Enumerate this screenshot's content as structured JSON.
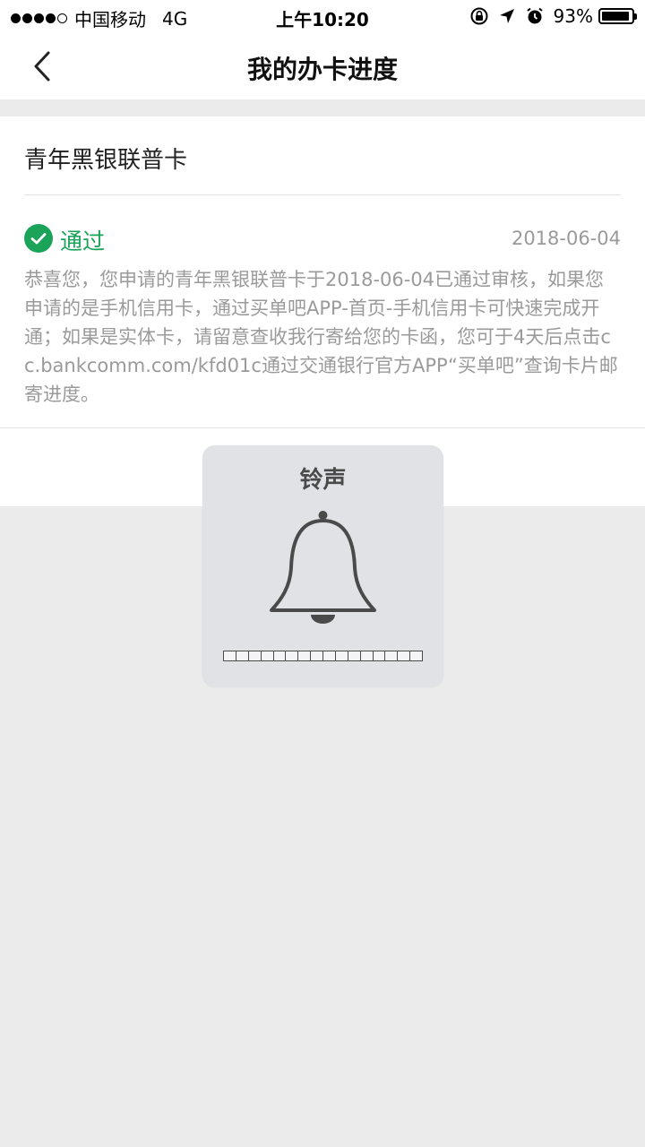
{
  "status_bar": {
    "carrier": "中国移动",
    "network": "4G",
    "time": "上午10:20",
    "battery": "93%",
    "battery_level": 0.93,
    "signal_bars": 4,
    "signal_total": 5
  },
  "nav": {
    "title": "我的办卡进度"
  },
  "card": {
    "name": "青年黑银联普卡",
    "status": "通过",
    "date": "2018-06-04",
    "description": "恭喜您，您申请的青年黑银联普卡于2018-06-04已通过审核，如果您申请的是手机信用卡，通过买单吧APP-首页-手机信用卡可快速完成开通；如果是实体卡，请留意查收我行寄给您的卡函，您可于4天后点击cc.bankcomm.com/kfd01c通过交通银行官方APP“买单吧”查询卡片邮寄进度。"
  },
  "ringer_hud": {
    "title": "铃声",
    "volume_level": 0,
    "volume_segments": 16
  },
  "colors": {
    "accent_green": "#1ba359",
    "muted_text": "#9a9a9a",
    "background": "#ebebeb"
  },
  "icons": {
    "back": "chevron-left-icon",
    "status": "check-circle-icon",
    "ringer": "bell-icon"
  }
}
